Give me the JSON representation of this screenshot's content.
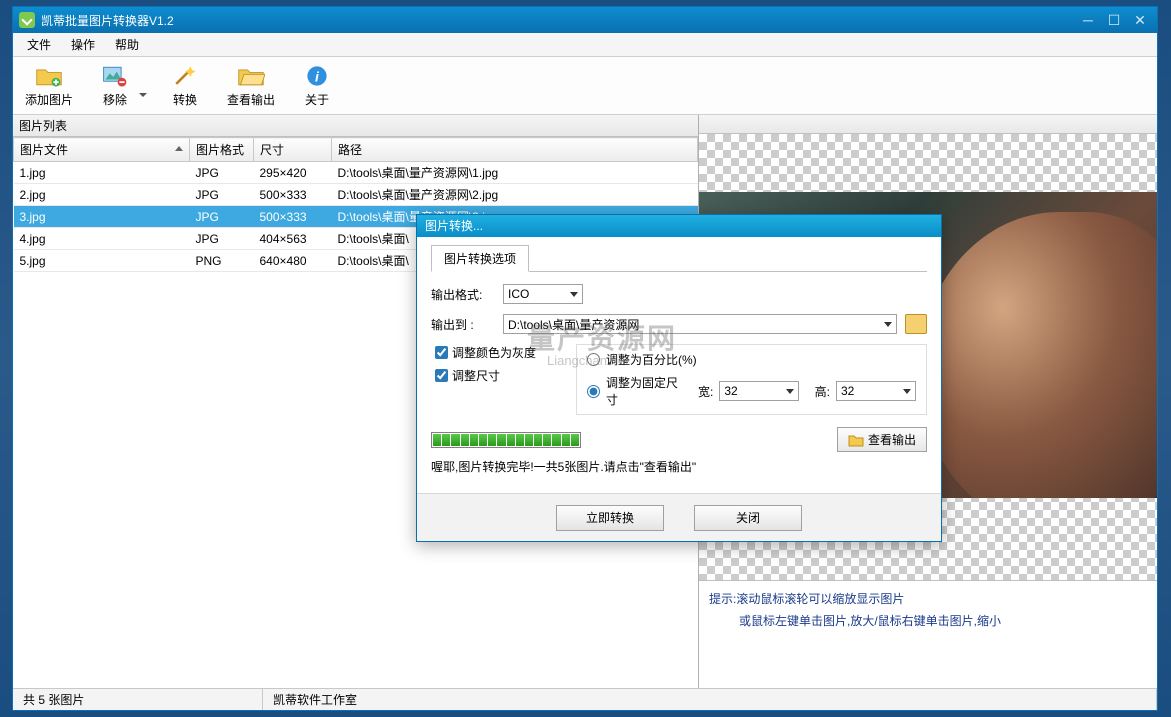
{
  "window": {
    "title": "凯蒂批量图片转换器V1.2"
  },
  "menubar": [
    "文件",
    "操作",
    "帮助"
  ],
  "toolbar": [
    {
      "id": "add-image",
      "label": "添加图片"
    },
    {
      "id": "remove",
      "label": "移除"
    },
    {
      "id": "convert",
      "label": "转换"
    },
    {
      "id": "view-output",
      "label": "查看输出"
    },
    {
      "id": "about",
      "label": "关于"
    }
  ],
  "list_header": "图片列表",
  "columns": {
    "file": "图片文件",
    "format": "图片格式",
    "size": "尺寸",
    "path": "路径"
  },
  "rows": [
    {
      "file": "1.jpg",
      "format": "JPG",
      "size": "295×420",
      "path": "D:\\tools\\桌面\\量产资源网\\1.jpg",
      "selected": false
    },
    {
      "file": "2.jpg",
      "format": "JPG",
      "size": "500×333",
      "path": "D:\\tools\\桌面\\量产资源网\\2.jpg",
      "selected": false
    },
    {
      "file": "3.jpg",
      "format": "JPG",
      "size": "500×333",
      "path": "D:\\tools\\桌面\\量产资源网\\3.jpg",
      "selected": true
    },
    {
      "file": "4.jpg",
      "format": "JPG",
      "size": "404×563",
      "path": "D:\\tools\\桌面\\",
      "selected": false
    },
    {
      "file": "5.jpg",
      "format": "PNG",
      "size": "640×480",
      "path": "D:\\tools\\桌面\\",
      "selected": false
    }
  ],
  "tips": {
    "line1": "提示:滚动鼠标滚轮可以缩放显示图片",
    "line2": "或鼠标左键单击图片,放大/鼠标右键单击图片,缩小"
  },
  "statusbar": {
    "count": "共 5 张图片",
    "author": "凯蒂软件工作室"
  },
  "dialog": {
    "title": "图片转换...",
    "tab": "图片转换选项",
    "format_label": "输出格式:",
    "format_value": "ICO",
    "output_label": "输出到   :",
    "output_path": "D:\\tools\\桌面\\量产资源网",
    "grayscale": "调整颜色为灰度",
    "resize": "调整尺寸",
    "resize_percent": "调整为百分比(%)",
    "resize_fixed": "调整为固定尺寸",
    "width_label": "宽:",
    "width_value": "32",
    "height_label": "高:",
    "height_value": "32",
    "view_output": "查看输出",
    "status": "喔耶,图片转换完毕!一共5张图片.请点击\"查看输出\"",
    "convert_btn": "立即转换",
    "close_btn": "关闭",
    "watermark": "量产资源网",
    "watermark_sub": "Liangchan.net"
  }
}
